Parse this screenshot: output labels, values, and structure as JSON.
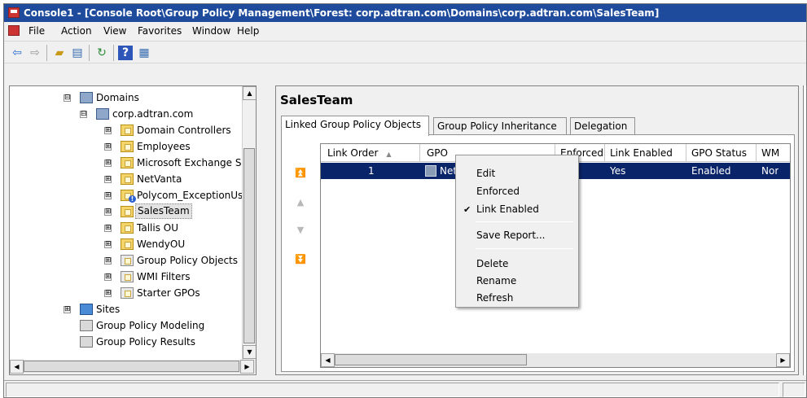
{
  "window": {
    "title": "Console1 - [Console Root\\Group Policy Management\\Forest: corp.adtran.com\\Domains\\corp.adtran.com\\SalesTeam]"
  },
  "menu": [
    "File",
    "Action",
    "View",
    "Favorites",
    "Window",
    "Help"
  ],
  "toolbar": [
    "back-icon",
    "forward-icon",
    "up-folder-icon",
    "show-hide-tree-icon",
    "refresh-icon",
    "help-icon",
    "properties-icon"
  ],
  "tree": [
    {
      "label": "Domains",
      "icon": "domains-icon",
      "expander": "⊟"
    },
    {
      "label": "corp.adtran.com",
      "icon": "domain-icon",
      "expander": "⊟"
    },
    {
      "label": "Domain Controllers",
      "icon": "ou-folder-icon",
      "expander": "⊞"
    },
    {
      "label": "Employees",
      "icon": "ou-folder-icon",
      "expander": "⊞"
    },
    {
      "label": "Microsoft Exchange Se",
      "icon": "ou-folder-icon",
      "expander": "⊞"
    },
    {
      "label": "NetVanta",
      "icon": "ou-folder-icon",
      "expander": "⊞"
    },
    {
      "label": "Polycom_ExceptionUs",
      "icon": "ou-folder-blocked-icon",
      "expander": "⊞"
    },
    {
      "label": "SalesTeam",
      "icon": "ou-folder-icon",
      "expander": "⊞"
    },
    {
      "label": "Tallis OU",
      "icon": "ou-folder-icon",
      "expander": "⊞"
    },
    {
      "label": "WendyOU",
      "icon": "ou-folder-icon",
      "expander": "⊞"
    },
    {
      "label": "Group Policy Objects",
      "icon": "gpo-container-icon",
      "expander": "⊞"
    },
    {
      "label": "WMI Filters",
      "icon": "wmi-filter-icon",
      "expander": "⊞"
    },
    {
      "label": "Starter GPOs",
      "icon": "starter-gpo-icon",
      "expander": "⊞"
    },
    {
      "label": "Sites",
      "icon": "sites-icon",
      "expander": "⊞"
    },
    {
      "label": "Group Policy Modeling",
      "icon": "gp-modeling-icon",
      "expander": ""
    },
    {
      "label": "Group Policy Results",
      "icon": "gp-results-icon",
      "expander": ""
    }
  ],
  "right": {
    "title": "SalesTeam",
    "tabs": [
      "Linked Group Policy Objects",
      "Group Policy Inheritance",
      "Delegation"
    ],
    "columns": [
      "Link Order",
      "GPO",
      "Enforced",
      "Link Enabled",
      "GPO Status",
      "WM"
    ],
    "sort_glyph": "▲",
    "row": {
      "link_order": "1",
      "gpo": "Net",
      "enforced": "",
      "link_enabled": "Yes",
      "gpo_status": "Enabled",
      "wmi": "Nor"
    }
  },
  "context_menu": {
    "items": [
      "Edit",
      "Enforced",
      "Link Enabled",
      "Save Report...",
      "Delete",
      "Rename",
      "Refresh"
    ],
    "checked": "✔"
  },
  "colors": {
    "title_bar": "#1f4b9c",
    "selection": "#0a246a",
    "folder": "#f3d56a"
  }
}
